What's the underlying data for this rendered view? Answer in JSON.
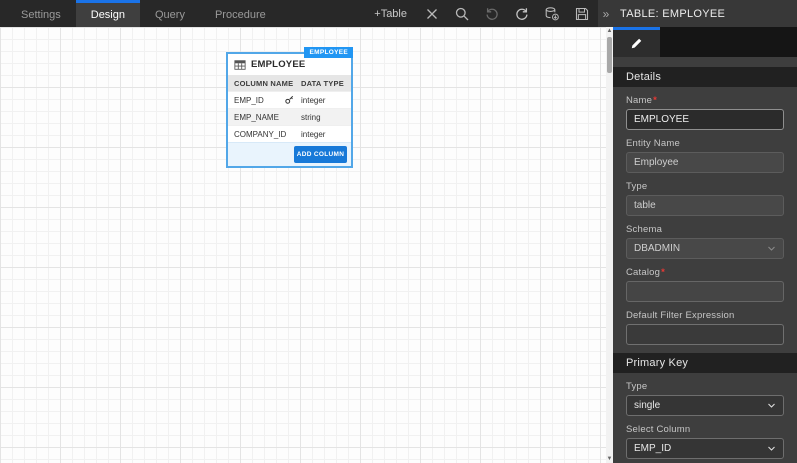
{
  "ui": {
    "required_marker": "*",
    "collapse_icon": "»"
  },
  "colors": {
    "accent": "#1a73e8",
    "badge_blue": "#2196f3",
    "card_border_blue": "#52a7e8",
    "button_blue": "#1779d8",
    "required_red": "#e53935"
  },
  "toolbar": {
    "tabs": [
      {
        "label": "Settings",
        "active": false
      },
      {
        "label": "Design",
        "active": true
      },
      {
        "label": "Query",
        "active": false
      },
      {
        "label": "Procedure",
        "active": false
      }
    ],
    "add_table_label": "+Table",
    "icons": [
      {
        "name": "delete-icon"
      },
      {
        "name": "search-icon"
      },
      {
        "name": "undo-icon",
        "disabled": true
      },
      {
        "name": "redo-icon"
      },
      {
        "name": "export-database-icon"
      },
      {
        "name": "save-icon"
      }
    ]
  },
  "canvas": {
    "table": {
      "badge": "EMPLOYEE",
      "title": "EMPLOYEE",
      "columns_header": {
        "name": "COLUMN NAME",
        "type": "DATA TYPE"
      },
      "rows": [
        {
          "name": "EMP_ID",
          "type": "integer",
          "primary_key": true
        },
        {
          "name": "EMP_NAME",
          "type": "string",
          "primary_key": false
        },
        {
          "name": "COMPANY_ID",
          "type": "integer",
          "primary_key": false
        }
      ],
      "add_column_label": "ADD COLUMN"
    }
  },
  "sidebar": {
    "header_title": "TABLE: EMPLOYEE",
    "tabs": [
      {
        "name": "edit-tab",
        "icon": "pencil"
      }
    ],
    "sections": {
      "details": {
        "title": "Details"
      },
      "primary_key": {
        "title": "Primary Key"
      }
    },
    "fields": {
      "name": {
        "label": "Name",
        "required": true,
        "value": "EMPLOYEE"
      },
      "entity_name": {
        "label": "Entity Name",
        "value": "Employee"
      },
      "type": {
        "label": "Type",
        "value": "table"
      },
      "schema": {
        "label": "Schema",
        "value": "DBADMIN"
      },
      "catalog": {
        "label": "Catalog",
        "required": true,
        "value": ""
      },
      "default_filter": {
        "label": "Default Filter Expression",
        "value": ""
      },
      "pk_type": {
        "label": "Type",
        "value": "single"
      },
      "pk_column": {
        "label": "Select Column",
        "value": "EMP_ID"
      }
    }
  }
}
